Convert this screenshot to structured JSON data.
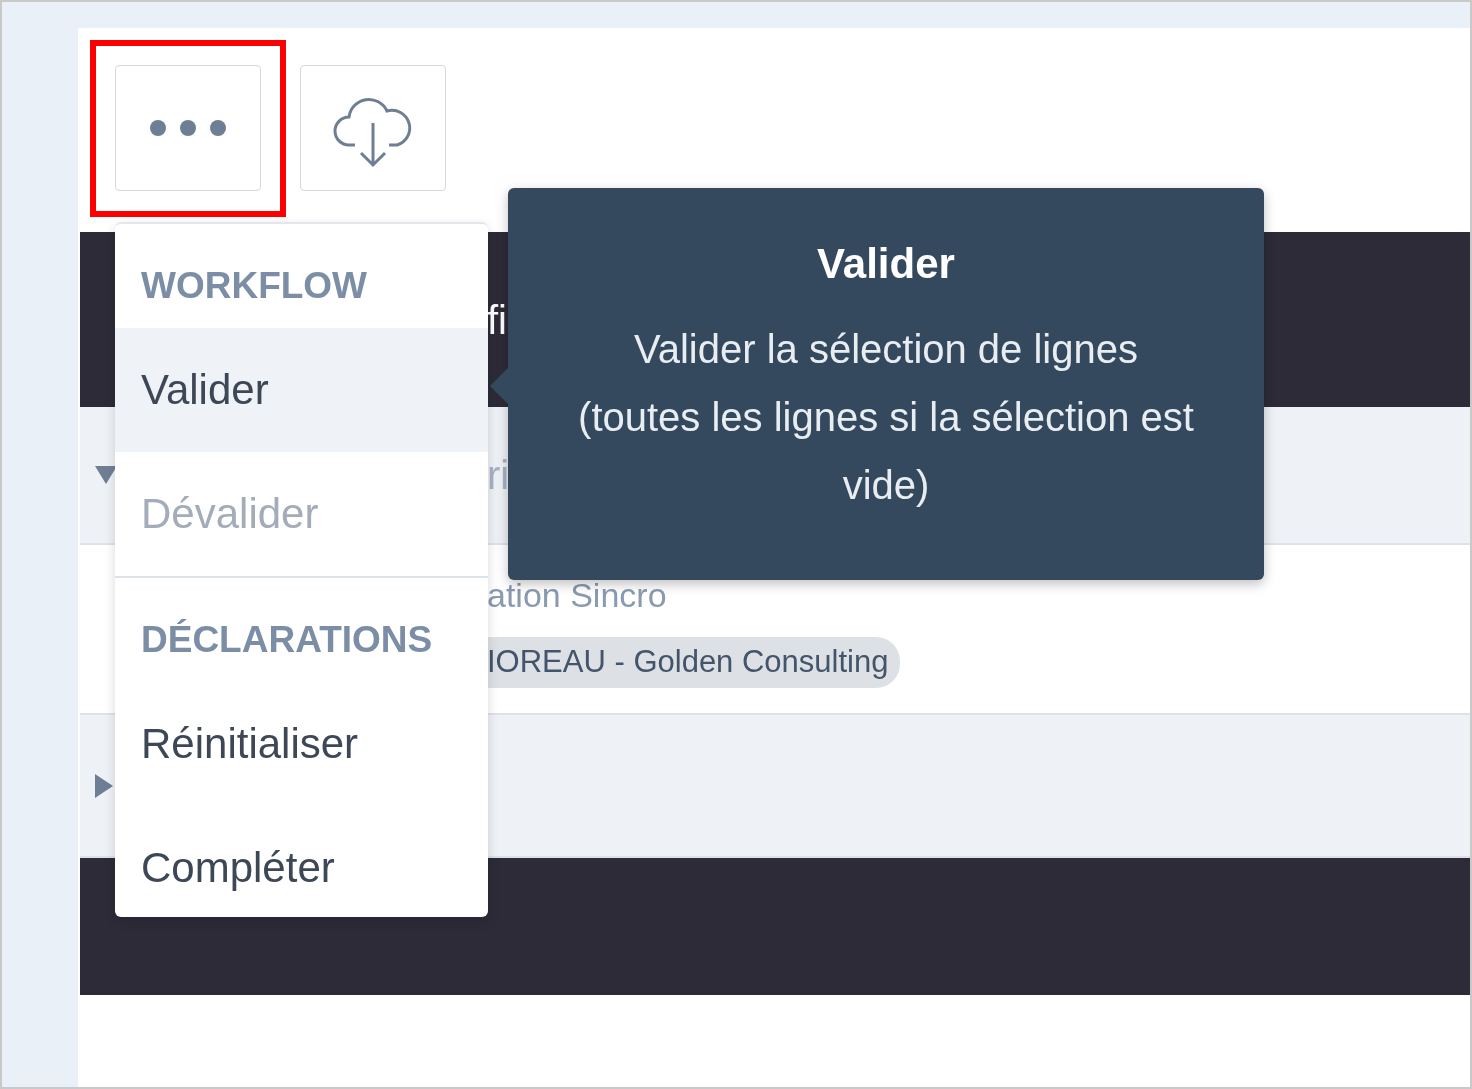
{
  "toolbar": {
    "buttons": [
      {
        "kind": "more",
        "highlighted": true
      },
      {
        "kind": "download",
        "highlighted": false
      }
    ]
  },
  "table": {
    "rows": [
      {
        "kind": "header",
        "text": "fi"
      },
      {
        "kind": "group",
        "expanded": true,
        "text": "ri"
      },
      {
        "kind": "item",
        "title": "ation Sincro",
        "tag": "IOREAU - Golden Consulting"
      },
      {
        "kind": "group",
        "expanded": false
      },
      {
        "kind": "band"
      }
    ]
  },
  "menu": {
    "sections": [
      {
        "heading": "WORKFLOW",
        "items": [
          {
            "label": "Valider",
            "selected": true,
            "disabled": false
          },
          {
            "label": "Dévalider",
            "selected": false,
            "disabled": true
          }
        ]
      },
      {
        "heading": "DÉCLARATIONS",
        "items": [
          {
            "label": "Réinitialiser",
            "selected": false,
            "disabled": false
          },
          {
            "label": "Compléter",
            "selected": false,
            "disabled": false
          }
        ]
      }
    ]
  },
  "tooltip": {
    "title": "Valider",
    "text": "Valider la sélection de lignes (toutes les lignes si la sélection est vide)"
  }
}
